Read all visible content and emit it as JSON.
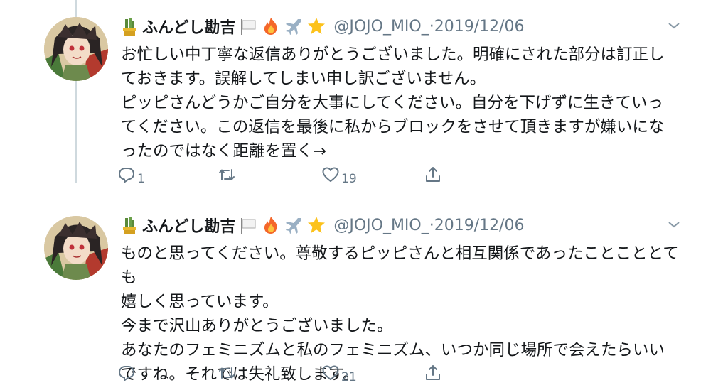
{
  "tweets": [
    {
      "display_name": "ふんどし勘吉",
      "name_emojis": [
        "white-flag-icon",
        "fire-icon",
        "airplane-icon",
        "star-icon"
      ],
      "handle": "@JOJO_MIO_",
      "separator": " · ",
      "date": "2019/12/06",
      "lines": [
        "お忙しい中丁寧な返信ありがとうございました。明確にされた部分は訂正し",
        "ておきます。誤解してしまい申し訳ございません。",
        "ピッピさんどうかご自分を大事にしてください。自分を下げずに生きていっ",
        "てください。この返信を最後に私からブロックをさせて頂きますが嫌いにな",
        "ったのではなく距離を置く→"
      ],
      "reply_count": "1",
      "retweet_count": "",
      "like_count": "19"
    },
    {
      "display_name": "ふんどし勘吉",
      "name_emojis": [
        "white-flag-icon",
        "fire-icon",
        "airplane-icon",
        "star-icon"
      ],
      "handle": "@JOJO_MIO_",
      "separator": " · ",
      "date": "2019/12/06",
      "lines": [
        "ものと思ってください。尊敬するピッピさんと相互関係であったことこととても",
        "嬉しく思っています。",
        "今まで沢山ありがとうございました。",
        "あなたのフェミニズムと私のフェミニズム、いつか同じ場所で会えたらいい",
        "ですね。それでは失礼致します。"
      ],
      "reply_count": "",
      "retweet_count": "",
      "like_count": "21"
    }
  ],
  "colors": {
    "text": "#14171a",
    "secondary": "#657786",
    "thread_line": "#cfd9de",
    "background": "#ffffff"
  }
}
